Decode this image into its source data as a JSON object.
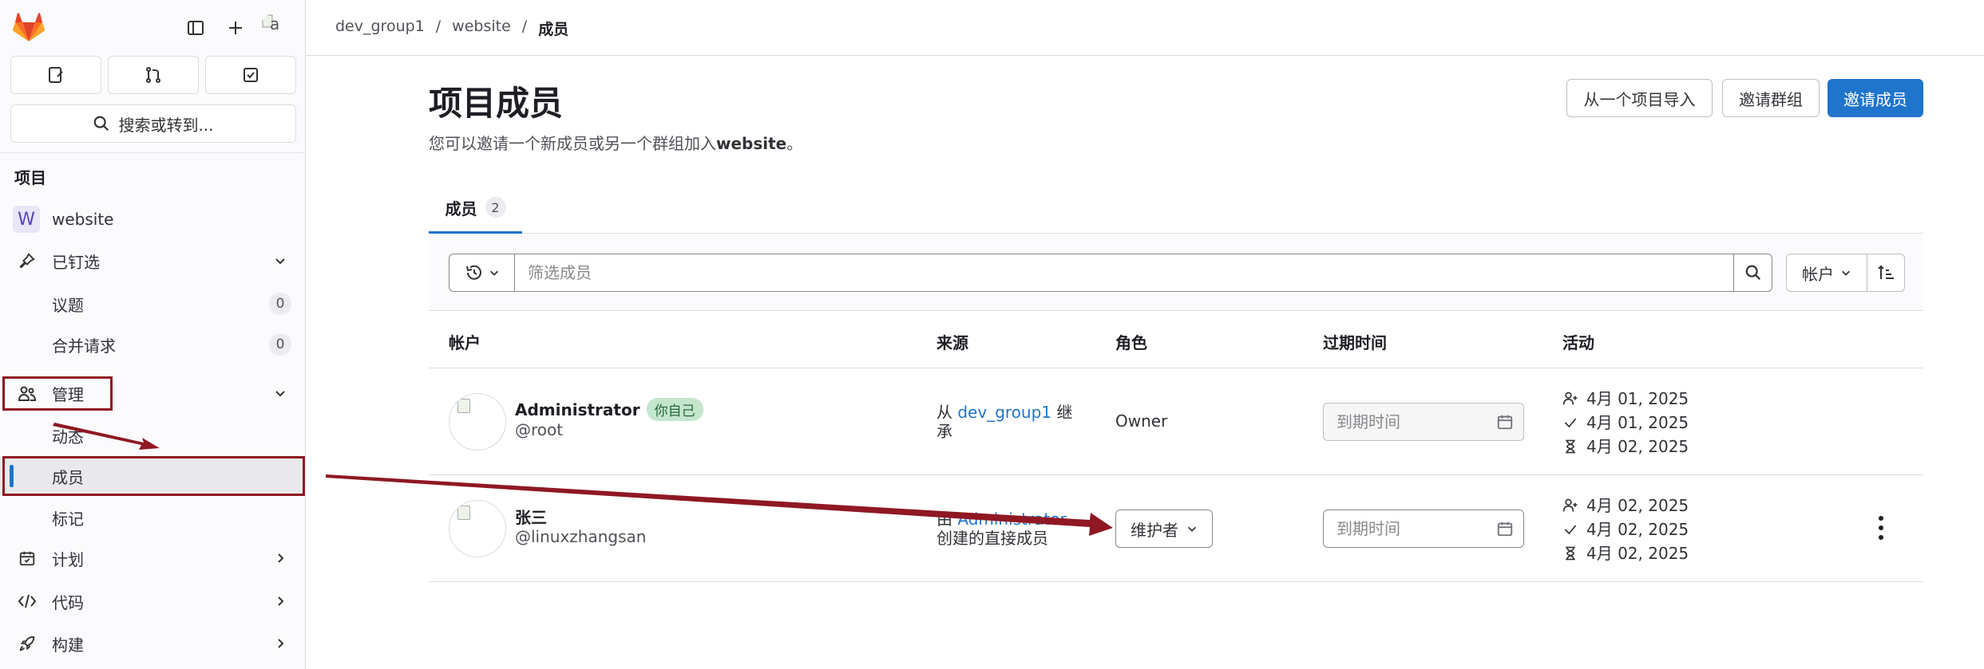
{
  "sidebar": {
    "avatar_text": "a",
    "search_label": "搜索或转到...",
    "section_title": "项目",
    "project_badge": "W",
    "project_name": "website",
    "items": [
      {
        "label": "已钉选"
      },
      {
        "label": "议题",
        "count": "0"
      },
      {
        "label": "合并请求",
        "count": "0"
      },
      {
        "label": "管理"
      },
      {
        "label": "动态"
      },
      {
        "label": "成员"
      },
      {
        "label": "标记"
      },
      {
        "label": "计划"
      },
      {
        "label": "代码"
      },
      {
        "label": "构建"
      }
    ]
  },
  "breadcrumb": {
    "items": [
      "dev_group1",
      "website",
      "成员"
    ],
    "separator": "/"
  },
  "header": {
    "title": "项目成员",
    "desc_prefix": "您可以邀请一个新成员或另一个群组加入",
    "desc_project": "website",
    "desc_suffix": "。",
    "import_button": "从一个项目导入",
    "invite_group_button": "邀请群组",
    "invite_member_button": "邀请成员"
  },
  "tabs": [
    {
      "label": "成员",
      "count": "2"
    }
  ],
  "filter": {
    "placeholder": "筛选成员",
    "sort_label": "帐户"
  },
  "table": {
    "columns": [
      "帐户",
      "来源",
      "角色",
      "过期时间",
      "活动"
    ],
    "rows": [
      {
        "name": "Administrator",
        "badge": "你自己",
        "handle": "@root",
        "source_prefix": "从 ",
        "source_link": "dev_group1",
        "source_suffix": " 继承",
        "role": "Owner",
        "expiry_placeholder": "到期时间",
        "activity": [
          "4月 01, 2025",
          "4月 01, 2025",
          "4月 02, 2025"
        ]
      },
      {
        "name": "张三",
        "handle": "@linuxzhangsan",
        "source_prefix": "由 ",
        "source_link": "Administrator",
        "source_suffix": "创建的直接成员",
        "role": "维护者",
        "expiry_placeholder": "到期时间",
        "activity": [
          "4月 02, 2025",
          "4月 02, 2025",
          "4月 02, 2025"
        ]
      }
    ]
  },
  "colors": {
    "accent": "#1f75cb",
    "annotation": "#8f1823",
    "sidebar_bg": "#fbfafd"
  }
}
